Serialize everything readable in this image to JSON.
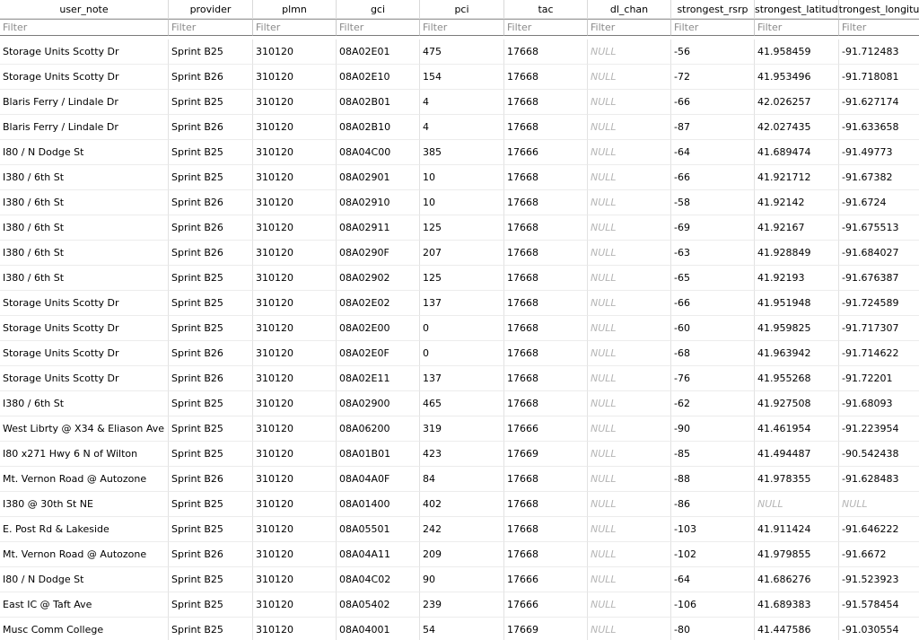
{
  "columns": [
    "user_note",
    "provider",
    "plmn",
    "gci",
    "pci",
    "tac",
    "dl_chan",
    "strongest_rsrp",
    "strongest_latitude",
    "strongest_longitude"
  ],
  "filter_placeholder": "Filter",
  "rows": [
    [
      "Storage Units Scotty Dr",
      "Sprint B25",
      "310120",
      "08A02E01",
      "475",
      "17668",
      "NULL",
      "-56",
      "41.958459",
      "-91.712483"
    ],
    [
      "Storage Units Scotty Dr",
      "Sprint B26",
      "310120",
      "08A02E10",
      "154",
      "17668",
      "NULL",
      "-72",
      "41.953496",
      "-91.718081"
    ],
    [
      "Blaris Ferry / Lindale Dr",
      "Sprint B25",
      "310120",
      "08A02B01",
      "4",
      "17668",
      "NULL",
      "-66",
      "42.026257",
      "-91.627174"
    ],
    [
      "Blaris Ferry / Lindale Dr",
      "Sprint B26",
      "310120",
      "08A02B10",
      "4",
      "17668",
      "NULL",
      "-87",
      "42.027435",
      "-91.633658"
    ],
    [
      "I80 / N Dodge St",
      "Sprint B25",
      "310120",
      "08A04C00",
      "385",
      "17666",
      "NULL",
      "-64",
      "41.689474",
      "-91.49773"
    ],
    [
      "I380 / 6th St",
      "Sprint B25",
      "310120",
      "08A02901",
      "10",
      "17668",
      "NULL",
      "-66",
      "41.921712",
      "-91.67382"
    ],
    [
      "I380 / 6th St",
      "Sprint B26",
      "310120",
      "08A02910",
      "10",
      "17668",
      "NULL",
      "-58",
      "41.92142",
      "-91.6724"
    ],
    [
      "I380 / 6th St",
      "Sprint B26",
      "310120",
      "08A02911",
      "125",
      "17668",
      "NULL",
      "-69",
      "41.92167",
      "-91.675513"
    ],
    [
      "I380 / 6th St",
      "Sprint B26",
      "310120",
      "08A0290F",
      "207",
      "17668",
      "NULL",
      "-63",
      "41.928849",
      "-91.684027"
    ],
    [
      "I380 / 6th St",
      "Sprint B25",
      "310120",
      "08A02902",
      "125",
      "17668",
      "NULL",
      "-65",
      "41.92193",
      "-91.676387"
    ],
    [
      "Storage Units Scotty Dr",
      "Sprint B25",
      "310120",
      "08A02E02",
      "137",
      "17668",
      "NULL",
      "-66",
      "41.951948",
      "-91.724589"
    ],
    [
      "Storage Units Scotty Dr",
      "Sprint B25",
      "310120",
      "08A02E00",
      "0",
      "17668",
      "NULL",
      "-60",
      "41.959825",
      "-91.717307"
    ],
    [
      "Storage Units Scotty Dr",
      "Sprint B26",
      "310120",
      "08A02E0F",
      "0",
      "17668",
      "NULL",
      "-68",
      "41.963942",
      "-91.714622"
    ],
    [
      "Storage Units Scotty Dr",
      "Sprint B26",
      "310120",
      "08A02E11",
      "137",
      "17668",
      "NULL",
      "-76",
      "41.955268",
      "-91.72201"
    ],
    [
      "I380 / 6th St",
      "Sprint B25",
      "310120",
      "08A02900",
      "465",
      "17668",
      "NULL",
      "-62",
      "41.927508",
      "-91.68093"
    ],
    [
      "West Librty @ X34 & Eliason Ave",
      "Sprint B25",
      "310120",
      "08A06200",
      "319",
      "17666",
      "NULL",
      "-90",
      "41.461954",
      "-91.223954"
    ],
    [
      "I80 x271 Hwy 6 N of Wilton",
      "Sprint B25",
      "310120",
      "08A01B01",
      "423",
      "17669",
      "NULL",
      "-85",
      "41.494487",
      "-90.542438"
    ],
    [
      "Mt. Vernon Road @ Autozone",
      "Sprint B26",
      "310120",
      "08A04A0F",
      "84",
      "17668",
      "NULL",
      "-88",
      "41.978355",
      "-91.628483"
    ],
    [
      "I380 @ 30th St NE",
      "Sprint B25",
      "310120",
      "08A01400",
      "402",
      "17668",
      "NULL",
      "-86",
      "NULL",
      "NULL"
    ],
    [
      "E. Post Rd & Lakeside",
      "Sprint B25",
      "310120",
      "08A05501",
      "242",
      "17668",
      "NULL",
      "-103",
      "41.911424",
      "-91.646222"
    ],
    [
      "Mt. Vernon Road @ Autozone",
      "Sprint B26",
      "310120",
      "08A04A11",
      "209",
      "17668",
      "NULL",
      "-102",
      "41.979855",
      "-91.6672"
    ],
    [
      "I80 / N Dodge St",
      "Sprint B25",
      "310120",
      "08A04C02",
      "90",
      "17666",
      "NULL",
      "-64",
      "41.686276",
      "-91.523923"
    ],
    [
      "East IC @ Taft Ave",
      "Sprint B25",
      "310120",
      "08A05402",
      "239",
      "17666",
      "NULL",
      "-106",
      "41.689383",
      "-91.578454"
    ],
    [
      "Musc Comm College",
      "Sprint B25",
      "310120",
      "08A04001",
      "54",
      "17669",
      "NULL",
      "-80",
      "41.447586",
      "-91.030554"
    ]
  ]
}
